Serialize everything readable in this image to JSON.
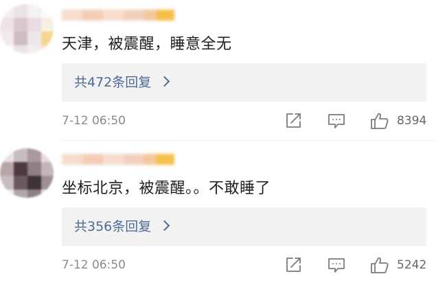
{
  "comments": [
    {
      "text": "天津，被震醒，睡意全无",
      "replies_label": "共472条回复",
      "time": "7-12 06:50",
      "likes": "8394"
    },
    {
      "text": "坐标北京，被震醒。。不敢睡了",
      "replies_label": "共356条回复",
      "time": "7-12 06:50",
      "likes": "5242"
    }
  ],
  "icons": {
    "share": "share-icon",
    "comment": "comment-icon",
    "like": "like-icon",
    "chevron": "chevron-right-icon"
  },
  "colors": {
    "link": "#4b6a97",
    "reply_bg": "#f2f2f2",
    "meta": "#8a8a8a"
  }
}
